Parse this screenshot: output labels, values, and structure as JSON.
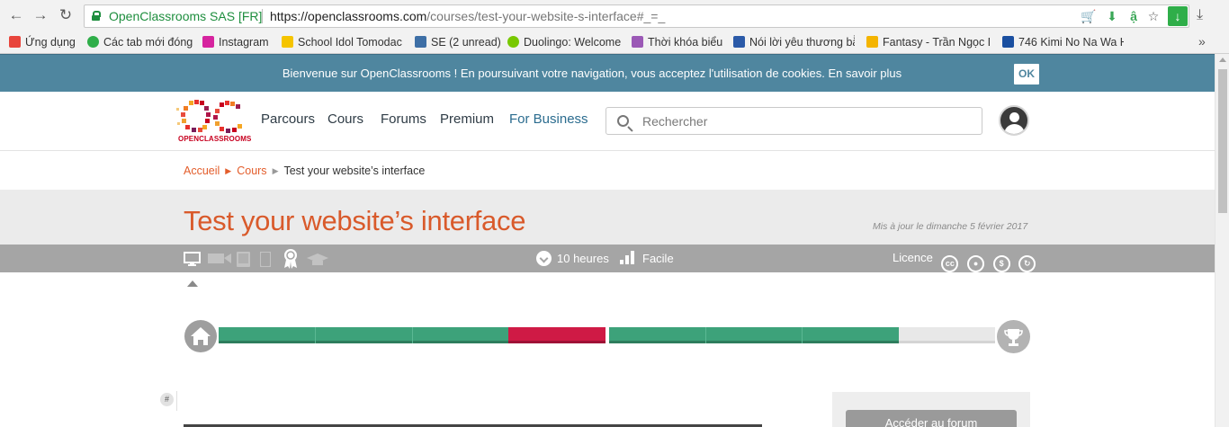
{
  "browser": {
    "site_identity": "OpenClassrooms SAS [FR]",
    "url_host": "https://openclassrooms.com",
    "url_path": "/courses/test-your-website-s-interface#_=_",
    "bookmarks": [
      {
        "label": "Ứng dụng",
        "color": "#e8453c"
      },
      {
        "label": "Các tab mới đóng",
        "color": "#2fae49"
      },
      {
        "label": "Instagram",
        "color": "#d6249f"
      },
      {
        "label": "School Idol Tomodach",
        "color": "#f5c400"
      },
      {
        "label": "SE (2 unread)",
        "color": "#3e6fa6"
      },
      {
        "label": "Duolingo: Welcome",
        "color": "#78c800"
      },
      {
        "label": "Thời khóa biểu",
        "color": "#9b59b6"
      },
      {
        "label": "Nói lời yêu thương bằ",
        "color": "#2b5aa8"
      },
      {
        "label": "Fantasy - Trần Ngọc D",
        "color": "#f4b400"
      },
      {
        "label": "746 Kimi No Na Wa H",
        "color": "#1a4fa0"
      }
    ],
    "more_label": "»"
  },
  "cookie_banner": {
    "text": "Bienvenue sur OpenClassrooms ! En poursuivant votre navigation, vous acceptez l'utilisation de cookies. En savoir plus",
    "ok_label": "OK"
  },
  "header": {
    "logo_text": "OPENCLASSROOMS",
    "nav": [
      "Parcours",
      "Cours",
      "Forums",
      "Premium",
      "For Business"
    ],
    "search_placeholder": "Rechercher"
  },
  "breadcrumb": {
    "home": "Accueil",
    "section": "Cours",
    "current": "Test your website’s interface"
  },
  "course": {
    "title": "Test your website’s interface",
    "updated": "Mis à jour le dimanche 5 février 2017",
    "duration": "10 heures",
    "difficulty": "Facile",
    "licence": "Licence"
  },
  "progress": {
    "parts": [
      {
        "chapters": [
          "done",
          "done",
          "done",
          "fail"
        ]
      },
      {
        "chapters": [
          "done",
          "done",
          "done",
          "todo"
        ]
      }
    ],
    "colors": {
      "done": "#3da27a",
      "fail": "#cf1a45",
      "todo": "#e8e8e8"
    }
  },
  "sidebar": {
    "anchor_label": "#",
    "forum_button": "Accéder au forum"
  },
  "icons": {
    "back": "arrow-left-icon",
    "forward": "arrow-right-icon",
    "reload": "reload-icon",
    "lock": "lock-icon",
    "search": "search-icon",
    "home": "home-icon",
    "trophy": "trophy-icon",
    "clock": "clock-icon",
    "difficulty": "difficulty-bars-icon"
  }
}
